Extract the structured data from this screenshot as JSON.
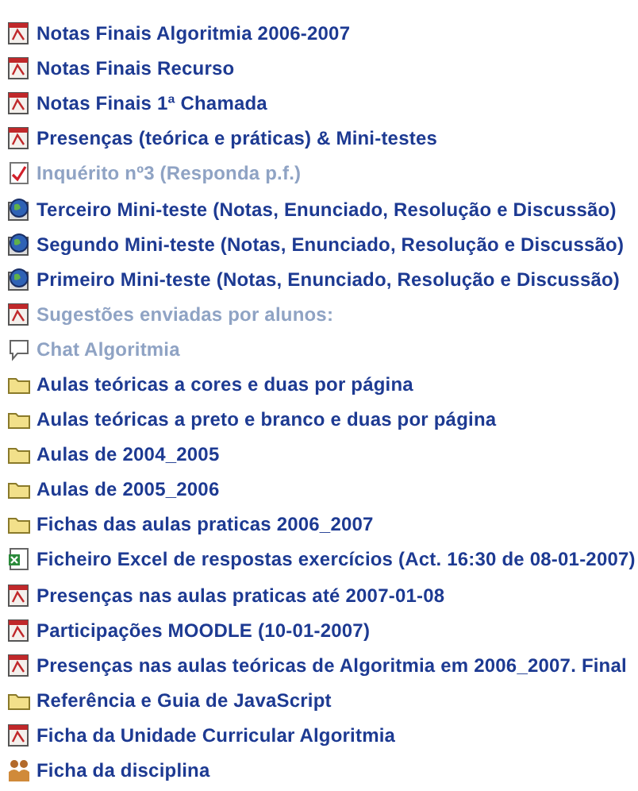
{
  "resources": [
    {
      "kind": "pdf",
      "label": "Notas Finais Algoritmia 2006-2007",
      "disabled": false
    },
    {
      "kind": "pdf",
      "label": "Notas Finais Recurso",
      "disabled": false
    },
    {
      "kind": "pdf",
      "label": "Notas Finais 1ª Chamada",
      "disabled": false
    },
    {
      "kind": "pdf",
      "label": "Presenças (teórica e práticas) & Mini-testes",
      "disabled": false
    },
    {
      "kind": "quiz",
      "label": "Inquérito nº3 (Responda p.f.)",
      "disabled": true
    },
    {
      "kind": "globe",
      "label": "Terceiro Mini-teste (Notas, Enunciado, Resolução e Discussão)",
      "disabled": false
    },
    {
      "kind": "globe",
      "label": "Segundo Mini-teste (Notas, Enunciado, Resolução e Discussão)",
      "disabled": false
    },
    {
      "kind": "globe",
      "label": "Primeiro Mini-teste (Notas, Enunciado, Resolução e Discussão)",
      "disabled": false
    },
    {
      "kind": "pdf",
      "label": "Sugestões enviadas por alunos:",
      "disabled": true
    },
    {
      "kind": "chat",
      "label": "Chat Algoritmia",
      "disabled": true
    },
    {
      "kind": "folder",
      "label": "Aulas teóricas a cores e duas por página",
      "disabled": false
    },
    {
      "kind": "folder",
      "label": "Aulas teóricas a preto e branco e duas por página",
      "disabled": false
    },
    {
      "kind": "folder",
      "label": "Aulas de 2004_2005",
      "disabled": false
    },
    {
      "kind": "folder",
      "label": "Aulas de 2005_2006",
      "disabled": false
    },
    {
      "kind": "folder",
      "label": "Fichas das aulas praticas 2006_2007",
      "disabled": false
    },
    {
      "kind": "excel",
      "label": "Ficheiro Excel de respostas exercícios (Act. 16:30 de 08-01-2007)",
      "disabled": false
    },
    {
      "kind": "pdf",
      "label": "Presenças nas aulas praticas até 2007-01-08",
      "disabled": false
    },
    {
      "kind": "pdf",
      "label": "Participações MOODLE (10-01-2007)",
      "disabled": false
    },
    {
      "kind": "pdf",
      "label": "Presenças nas aulas teóricas de Algoritmia em 2006_2007. Final",
      "disabled": false
    },
    {
      "kind": "folder",
      "label": "Referência e Guia de JavaScript",
      "disabled": false
    },
    {
      "kind": "pdf",
      "label": "Ficha da Unidade Curricular Algoritmia",
      "disabled": false
    },
    {
      "kind": "people",
      "label": "Ficha da disciplina",
      "disabled": false
    }
  ]
}
